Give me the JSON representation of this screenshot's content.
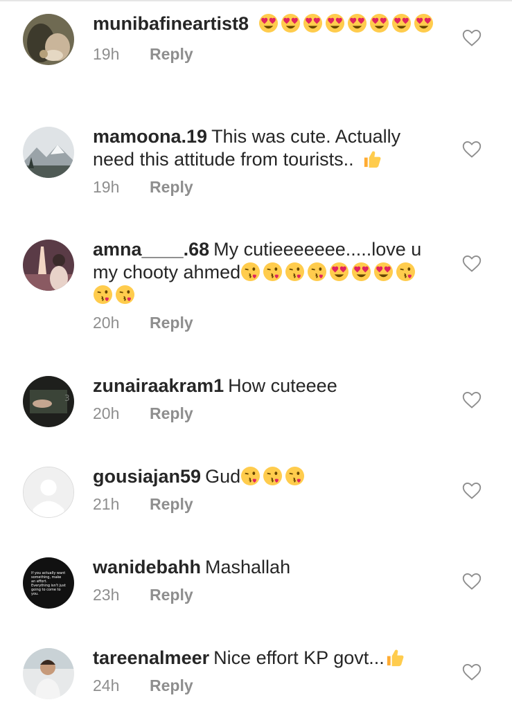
{
  "comments": [
    {
      "username": "munibafineartist8",
      "text": "",
      "emojis": [
        "heart-eyes",
        "heart-eyes",
        "heart-eyes",
        "heart-eyes",
        "heart-eyes",
        "heart-eyes",
        "heart-eyes",
        "heart-eyes"
      ],
      "time": "19h",
      "reply": "Reply",
      "avatar": "avatar-photo-hands"
    },
    {
      "username": "mamoona.19",
      "text": "This was cute. Actually need this attitude from tourists..",
      "emojis": [
        "thumbs-up"
      ],
      "time": "19h",
      "reply": "Reply",
      "avatar": "avatar-photo-mountains"
    },
    {
      "username": "amna____.68",
      "text": "My cutieeeeeee.....love u my chooty ahmed",
      "emojis": [
        "kiss",
        "kiss",
        "kiss",
        "kiss",
        "heart-eyes",
        "heart-eyes",
        "heart-eyes",
        "kiss",
        "kiss",
        "kiss"
      ],
      "time": "20h",
      "reply": "Reply",
      "avatar": "avatar-photo-eiffel"
    },
    {
      "username": "zunairaakram1",
      "text": "How cuteeee",
      "emojis": [],
      "time": "20h",
      "reply": "Reply",
      "avatar": "avatar-photo-dark"
    },
    {
      "username": "gousiajan59",
      "text": "Gud",
      "emojis": [
        "kiss",
        "kiss",
        "kiss"
      ],
      "time": "21h",
      "reply": "Reply",
      "avatar": "avatar-default"
    },
    {
      "username": "wanidebahh",
      "text": "Mashallah",
      "emojis": [],
      "time": "23h",
      "reply": "Reply",
      "avatar": "avatar-quote",
      "avatar_text": "If you actually want something, make an effort. Everything isn't just going to come to you."
    },
    {
      "username": "tareenalmeer",
      "text": "Nice effort KP govt...",
      "emojis": [
        "thumbs-up"
      ],
      "time": "24h",
      "reply": "Reply",
      "avatar": "avatar-photo-child"
    }
  ],
  "icons": {
    "like": "heart-outline-icon"
  },
  "colors": {
    "text": "#262626",
    "meta": "#8e8e8e",
    "emoji": "#ffcc4d"
  }
}
